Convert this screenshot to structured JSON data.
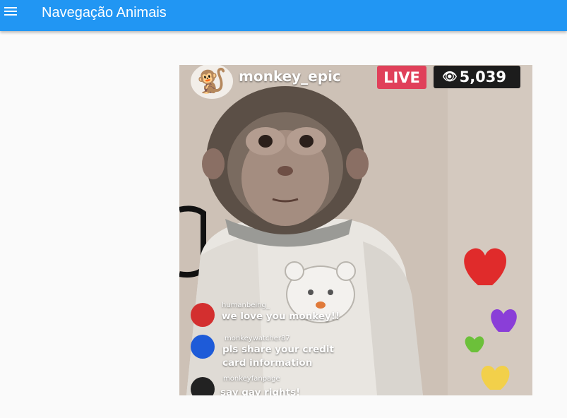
{
  "appbar": {
    "title": "Navegação Animais",
    "menu_icon": "menu-icon",
    "color": "#2196f3"
  },
  "live_image": {
    "username": "monkey_epic",
    "avatar_emoji": "🐒",
    "live_label": "LIVE",
    "viewer_icon": "👁",
    "viewer_count": "5,039",
    "comments": [
      {
        "user": "humanbeing_",
        "message": "we love you monkey!!",
        "color": "#d32f2f"
      },
      {
        "user": "monkeywatcher87",
        "message": "pls share your credit",
        "message2": "card information",
        "color": "#1e5bd8"
      },
      {
        "user": "monkeyfanpage",
        "message": "say gay rights!",
        "color": "#222222"
      }
    ],
    "hearts": [
      "red",
      "purple",
      "green",
      "yellow"
    ]
  }
}
